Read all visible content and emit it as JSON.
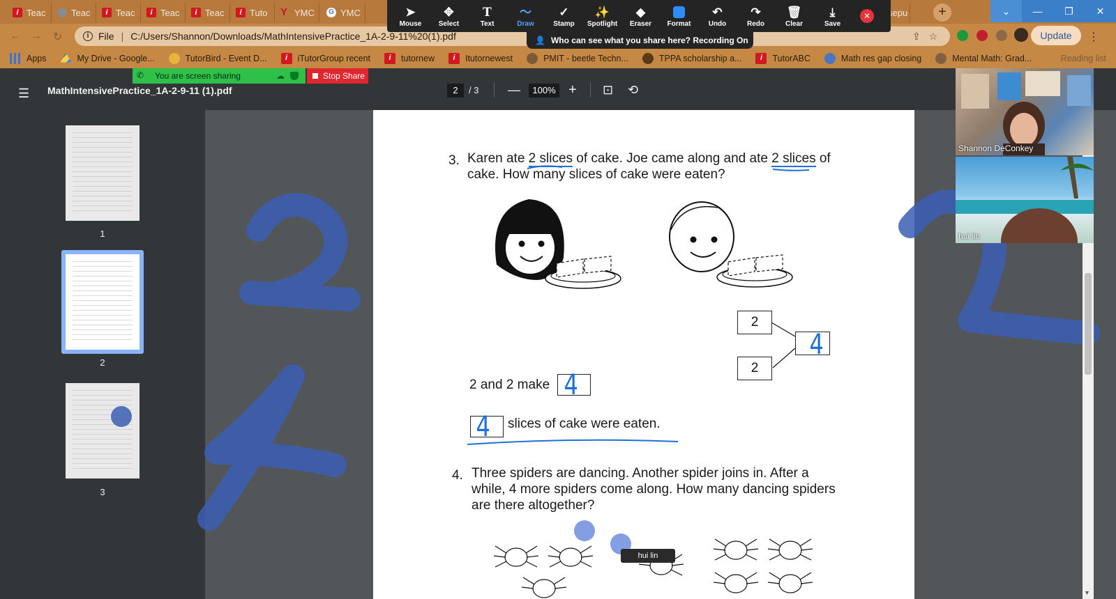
{
  "browser": {
    "tabs": [
      {
        "label": "Teac",
        "icon": "itutor-icon"
      },
      {
        "label": "Teac",
        "icon": "globe-icon"
      },
      {
        "label": "Teac",
        "icon": "itutor-icon"
      },
      {
        "label": "Teac",
        "icon": "itutor-icon"
      },
      {
        "label": "Teac",
        "icon": "itutor-icon"
      },
      {
        "label": "Tuto",
        "icon": "itutor-icon"
      },
      {
        "label": "YMC",
        "icon": "yahoo-icon"
      },
      {
        "label": "YMC",
        "icon": "google-translate-icon"
      },
      {
        "label": "sepu",
        "icon": "google-icon"
      }
    ],
    "new_tab_label": "+",
    "window_buttons": {
      "minimize": "—",
      "restore": "❐",
      "close": "✕",
      "tab_search": "⌄"
    },
    "address": {
      "scheme_label": "File",
      "url": "C:/Users/Shannon/Downloads/MathIntensivePractice_1A-2-9-11%20(1).pdf"
    },
    "update_label": "Update",
    "bookmarks": [
      {
        "label": "Apps",
        "icon": "apps-icon"
      },
      {
        "label": "My Drive - Google...",
        "icon": "google-drive-icon"
      },
      {
        "label": "TutorBird - Event D...",
        "icon": "tutorbird-icon"
      },
      {
        "label": "iTutorGroup recent",
        "icon": "itutor-icon"
      },
      {
        "label": "tutornew",
        "icon": "itutor-icon"
      },
      {
        "label": "Itutornewest",
        "icon": "itutor-icon"
      },
      {
        "label": "PMIT - beetle Techn...",
        "icon": "pmit-icon"
      },
      {
        "label": "TPPA scholarship a...",
        "icon": "tppa-icon"
      },
      {
        "label": "TutorABC",
        "icon": "itutor-icon"
      },
      {
        "label": "Math res gap closing",
        "icon": "globe-icon"
      },
      {
        "label": "Mental Math: Grad...",
        "icon": "mentalmath-icon"
      }
    ],
    "reading_list_label": "Reading list"
  },
  "zoom": {
    "tools": [
      {
        "label": "Mouse",
        "glyph": "➤"
      },
      {
        "label": "Select",
        "glyph": "✥"
      },
      {
        "label": "Text",
        "glyph": "T"
      },
      {
        "label": "Draw",
        "glyph": "〜"
      },
      {
        "label": "Stamp",
        "glyph": "✓"
      },
      {
        "label": "Spotlight",
        "glyph": "✨"
      },
      {
        "label": "Eraser",
        "glyph": "◆"
      },
      {
        "label": "Format",
        "glyph": ""
      },
      {
        "label": "Undo",
        "glyph": "↶"
      },
      {
        "label": "Redo",
        "glyph": "↷"
      },
      {
        "label": "Clear",
        "glyph": "🗑"
      },
      {
        "label": "Save",
        "glyph": "⤓"
      }
    ],
    "active_tool": "Draw",
    "close_glyph": "✕",
    "recording_text": "Who can see what you share here? Recording On",
    "sharing_text": "You are screen sharing",
    "stop_share_label": "Stop Share"
  },
  "pdf": {
    "filename": "MathIntensivePractice_1A-2-9-11 (1).pdf",
    "current_page": "2",
    "total_pages": "/ 3",
    "zoom_level": "100%",
    "zoom_out": "—",
    "zoom_in": "+",
    "thumbnails": [
      "1",
      "2",
      "3"
    ],
    "selected_page": "2"
  },
  "worksheet": {
    "q3_number": "3.",
    "q3_line1_a": "Karen ate ",
    "q3_line1_u1": "2 slices",
    "q3_line1_b": " of cake. Joe came along and ate ",
    "q3_line1_u2": "2 slices",
    "q3_line1_c": " of",
    "q3_line2": "cake. How many slices of cake were eaten?",
    "bond_part1": "2",
    "bond_part2": "2",
    "make_text": "2 and 2 make",
    "eaten_text": "slices of cake were eaten.",
    "q4_number": "4.",
    "q4_line1": "Three spiders are dancing. Another spider joins in. After a",
    "q4_line2": "while, 4 more spiders come along. How many dancing spiders",
    "q4_line3": "are there altogether?",
    "handwritten": {
      "bond_whole": "4",
      "make_answer": "4",
      "eaten_answer": "4"
    }
  },
  "participants": [
    {
      "name": "Shannon DeConkey"
    },
    {
      "name": "hui lin"
    }
  ],
  "hover_name": "hui lin",
  "colors": {
    "tab_strip": "#b87a3c",
    "zoom_toolbar": "#242424",
    "share_green": "#2fc04a",
    "stop_red": "#e0262e",
    "pdf_toolbar": "#323639",
    "annotation_blue": "#3c5fb4",
    "pen_blue": "#1f6fd8"
  }
}
